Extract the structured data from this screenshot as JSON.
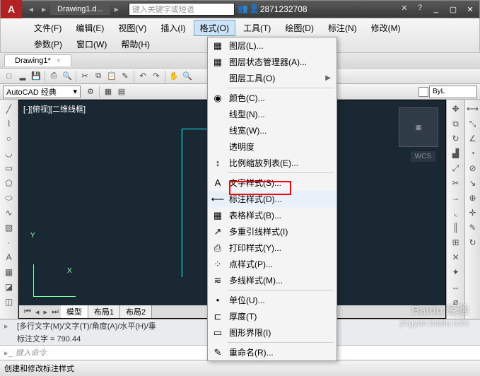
{
  "title": {
    "doc": "Drawing1.d...",
    "search_placeholder": "键入关键字或短语",
    "user": "2871232708"
  },
  "menu": {
    "row1": [
      "文件(F)",
      "编辑(E)",
      "视图(V)",
      "插入(I)",
      "格式(O)",
      "工具(T)",
      "绘图(D)",
      "标注(N)",
      "修改(M)"
    ],
    "row2": [
      "参数(P)",
      "窗口(W)",
      "帮助(H)"
    ],
    "active_index": 4
  },
  "tab": {
    "name": "Drawing1*",
    "close": "×"
  },
  "workspace": "AutoCAD 经典",
  "layer_current": "ByL",
  "canvas": {
    "label": "[-][俯视][二维线框]",
    "wcs": "WCS",
    "y": "Y",
    "x": "X"
  },
  "layout_tabs": {
    "model": "模型",
    "l1": "布局1",
    "l2": "布局2"
  },
  "dropdown": {
    "items": [
      {
        "icon": "▦",
        "label": "图层(L)..."
      },
      {
        "icon": "▦",
        "label": "图层状态管理器(A)..."
      },
      {
        "icon": "",
        "label": "图层工具(O)",
        "sub": true
      },
      {
        "sep": true
      },
      {
        "icon": "◉",
        "label": "颜色(C)..."
      },
      {
        "icon": "",
        "label": "线型(N)..."
      },
      {
        "icon": "",
        "label": "线宽(W)..."
      },
      {
        "icon": "",
        "label": "透明度"
      },
      {
        "icon": "↕",
        "label": "比例缩放列表(E)..."
      },
      {
        "sep": true
      },
      {
        "icon": "A",
        "label": "文字样式(S)..."
      },
      {
        "icon": "⟵",
        "label": "标注样式(D)...",
        "hl": true
      },
      {
        "icon": "▦",
        "label": "表格样式(B)..."
      },
      {
        "icon": "↗",
        "label": "多重引线样式(I)"
      },
      {
        "icon": "⎙",
        "label": "打印样式(Y)..."
      },
      {
        "icon": "⁘",
        "label": "点样式(P)..."
      },
      {
        "icon": "≋",
        "label": "多线样式(M)..."
      },
      {
        "sep": true
      },
      {
        "icon": "•",
        "label": "单位(U)..."
      },
      {
        "icon": "⊏",
        "label": "厚度(T)"
      },
      {
        "icon": "▭",
        "label": "图形界限(I)"
      },
      {
        "sep": true
      },
      {
        "icon": "✎",
        "label": "重命名(R)..."
      }
    ]
  },
  "cmd": {
    "line1": "[多行文字(M)/文字(T)/角度(A)/水平(H)/垂",
    "line2": "标注文字 = 790.44",
    "prompt": "键入命令"
  },
  "status": "创建和修改标注样式",
  "watermark": {
    "brand": "Baidu 经验",
    "url": "jingyan.baidu.com"
  }
}
